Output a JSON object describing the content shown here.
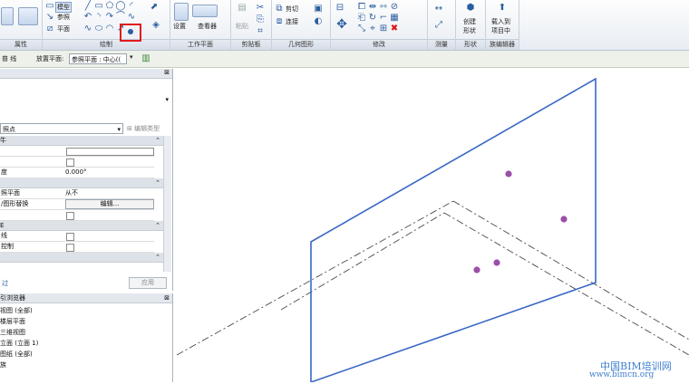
{
  "ribbon": {
    "panels": [
      {
        "id": "props",
        "label": "属性"
      },
      {
        "id": "draw",
        "label": "绘制"
      },
      {
        "id": "workplane",
        "label": "工作平面"
      },
      {
        "id": "clipboard",
        "label": "剪贴板"
      },
      {
        "id": "geometry",
        "label": "几何图形"
      },
      {
        "id": "modify",
        "label": "修改"
      },
      {
        "id": "measure",
        "label": "测量"
      },
      {
        "id": "form",
        "label": "形状"
      },
      {
        "id": "family",
        "label": "族编辑器"
      }
    ],
    "draw_model": "模型",
    "draw_ref": "参照",
    "draw_plane": "平面",
    "workplane_set": "设置",
    "workplane_viewer": "查看器",
    "clipboard_paste": "粘贴",
    "geometry_cut": "剪切",
    "geometry_join": "连接",
    "form_create": "创建",
    "form_shape": "形状",
    "family_load1": "载入到",
    "family_load2": "项目中"
  },
  "options_bar": {
    "mode": "普 线",
    "placement_label": "放置平面:",
    "placement_value": "参照平面 : 中心(("
  },
  "properties": {
    "type_label": "照点",
    "edit_type": "编辑类型",
    "sections": [
      "牛",
      "",
      "E",
      ""
    ],
    "rows": [
      {
        "label": "",
        "value": ""
      },
      {
        "label": "",
        "value": ""
      },
      {
        "label": "度",
        "value": "0.000°"
      },
      {
        "label": "照平面",
        "value": "从不"
      },
      {
        "label": "/图形替换",
        "value": "编辑..."
      },
      {
        "label": "",
        "value": ""
      },
      {
        "label": "线",
        "value": ""
      },
      {
        "label": "控制",
        "value": ""
      }
    ],
    "help": "过",
    "apply": "应用"
  },
  "browser": {
    "title": "引浏览器",
    "items": [
      "视图 (全部)",
      "楼层平面",
      "三维视图",
      "立面 (立面 1)",
      "图纸 (全部)",
      "族"
    ]
  },
  "watermark": {
    "line1": "中国BIM培训网",
    "line2": "www.bimcn.org"
  },
  "colors": {
    "plane": "#3a68c7",
    "points": "#9b4fa8",
    "guides": "#4a4a4a",
    "highlight": "#e01b1b"
  }
}
